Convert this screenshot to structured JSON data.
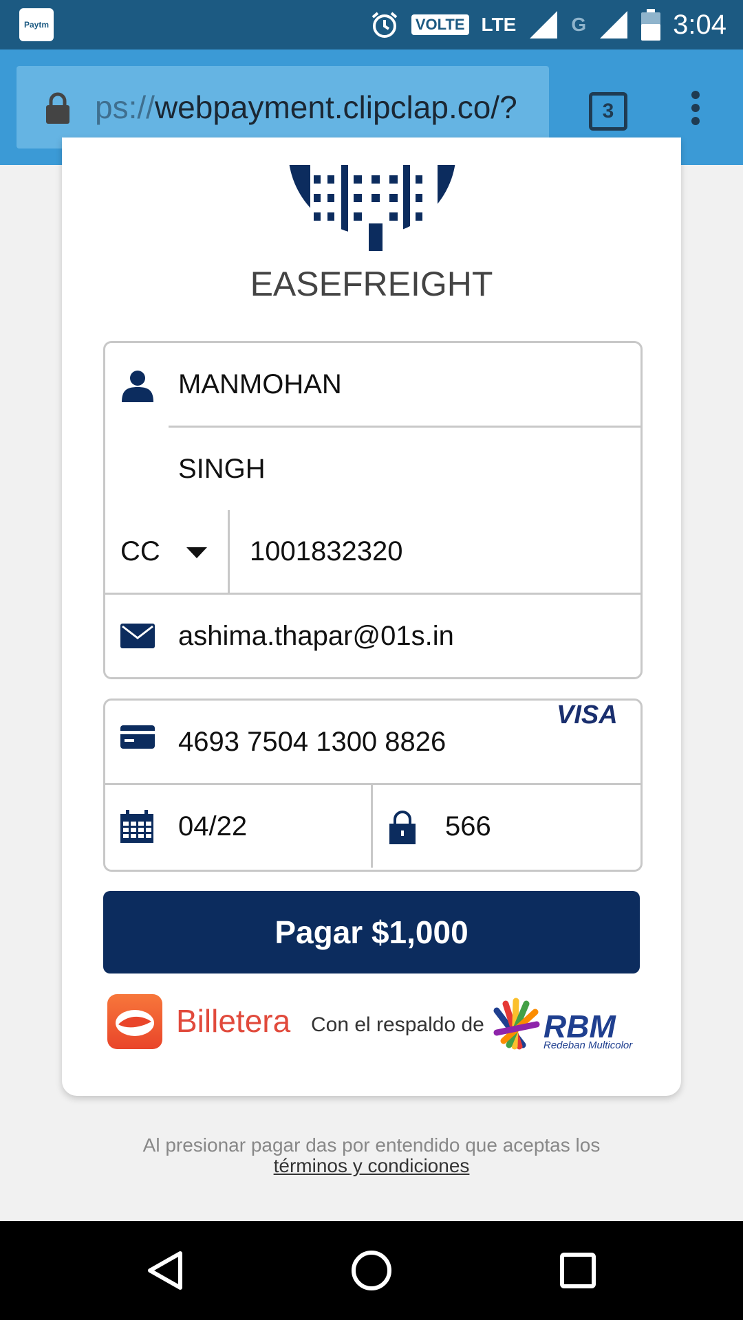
{
  "status_bar": {
    "paytm_badge": "Paytm",
    "volte": "VOLTE",
    "lte": "LTE",
    "g": "G",
    "time": "3:04"
  },
  "browser": {
    "url_prefix": "ps://",
    "url": "webpayment.clipclap.co/?",
    "tab_count": "3"
  },
  "merchant": {
    "name": "EASEFREIGHT"
  },
  "form": {
    "first_name": "MANMOHAN",
    "last_name": "SINGH",
    "id_type": "CC",
    "id_number": "1001832320",
    "email": "ashima.thapar@01s.in",
    "card_number": "4693 7504 1300 8826",
    "card_brand": "VISA",
    "expiry": "04/22",
    "cvv": "566"
  },
  "pay_button": "Pagar $1,000",
  "footer": {
    "billetera": "Billetera",
    "respaldo": "Con el respaldo de",
    "rbm": "RBM",
    "rbm_sub": "Redeban Multicolor",
    "terms_text": "Al presionar pagar das por entendido que aceptas los",
    "terms_link": "términos y condiciones"
  },
  "colors": {
    "status_bar": "#1c5a82",
    "url_bar": "#3b9ad6",
    "primary": "#0c2c5e",
    "billetera": "#e14a3c"
  },
  "icons": [
    "alarm-icon",
    "signal-icon",
    "battery-icon",
    "lock-icon",
    "person-icon",
    "chevron-down-icon",
    "mail-icon",
    "credit-card-icon",
    "calendar-icon",
    "padlock-icon",
    "back-icon",
    "home-icon",
    "recents-icon"
  ]
}
